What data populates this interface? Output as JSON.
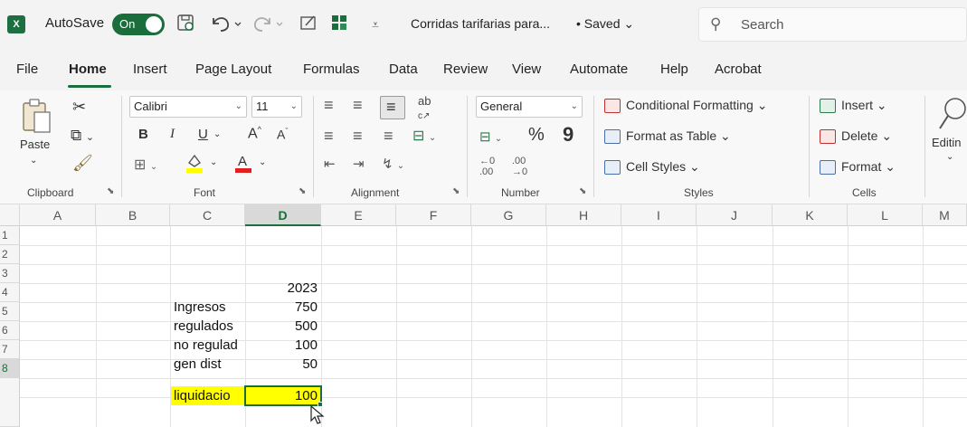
{
  "titlebar": {
    "autosave_label": "AutoSave",
    "autosave_state": "On",
    "filename": "Corridas tarifarias para...",
    "saved_status": "• Saved ⌄",
    "search_placeholder": "Search",
    "logo": "X"
  },
  "tabs": [
    "File",
    "Home",
    "Insert",
    "Page Layout",
    "Formulas",
    "Data",
    "Review",
    "View",
    "Automate",
    "Help",
    "Acrobat"
  ],
  "ribbon": {
    "clipboard": {
      "paste": "Paste",
      "label": "Clipboard"
    },
    "font": {
      "name": "Calibri",
      "size": "11",
      "label": "Font",
      "bold": "B",
      "italic": "I",
      "underline": "U"
    },
    "alignment": {
      "label": "Alignment"
    },
    "number": {
      "format": "General",
      "percent": "%",
      "comma": "9",
      "label": "Number"
    },
    "styles": {
      "conditional": "Conditional Formatting ⌄",
      "table": "Format as Table ⌄",
      "cell_styles": "Cell Styles ⌄",
      "label": "Styles"
    },
    "cells": {
      "insert": "Insert  ⌄",
      "delete": "Delete  ⌄",
      "format": "Format ⌄",
      "label": "Cells"
    },
    "editing": {
      "label": "Editin"
    }
  },
  "grid": {
    "columns": [
      "A",
      "B",
      "C",
      "D",
      "E",
      "F",
      "G",
      "H",
      "I",
      "J",
      "K",
      "L",
      "M"
    ],
    "row_numbers": [
      "1",
      "2",
      "3",
      "4",
      "5",
      "6",
      "7",
      "8"
    ],
    "cells": {
      "D3": "2023",
      "C4": "Ingresos",
      "D4": "750",
      "C5": "regulados",
      "D5": "500",
      "C6": "no regulad",
      "D6": "100",
      "C7": "gen dist",
      "D7": "50",
      "C8": "liquidacio",
      "D8": "100"
    },
    "highlight_color": "#ffff00",
    "active_cell": "D8",
    "accent": "#1a6e3c"
  }
}
